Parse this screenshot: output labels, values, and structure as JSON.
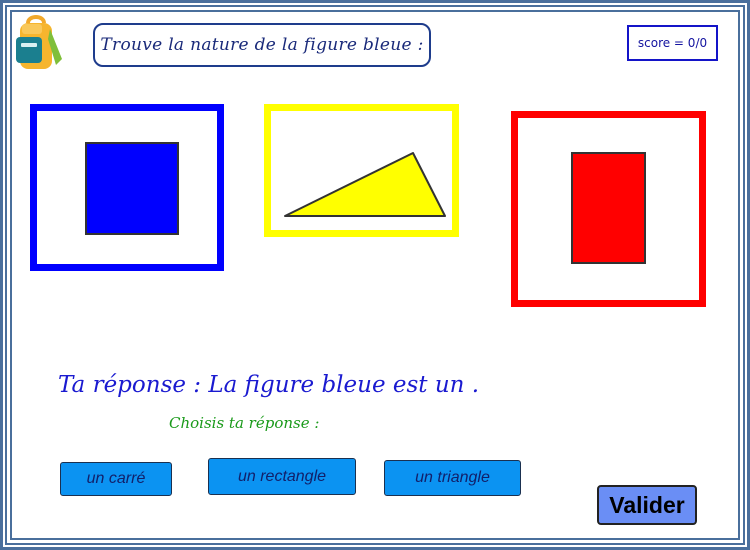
{
  "header": {
    "instruction": "Trouve la nature de la figure bleue :",
    "score": "score = 0/0"
  },
  "shapes": [
    {
      "name": "square",
      "fill": "#0000ff",
      "frame": "#0000ff"
    },
    {
      "name": "triangle",
      "fill": "#ffff00",
      "frame": "#ffff00"
    },
    {
      "name": "rectangle",
      "fill": "#ff0000",
      "frame": "#ff0000"
    }
  ],
  "answer": {
    "sentence": "Ta réponse : La figure bleue est un .",
    "prompt": "Choisis ta réponse :"
  },
  "choices": [
    "un carré",
    "un rectangle",
    "un triangle"
  ],
  "validate_label": "Valider",
  "colors": {
    "border": "#4a6f9c",
    "choice_button": "#0b93f2",
    "validate_button": "#6a8ef5",
    "answer_text": "#1a1ad0",
    "prompt_text": "#1a9a1a"
  },
  "icons": {
    "logo": "backpack-icon"
  }
}
